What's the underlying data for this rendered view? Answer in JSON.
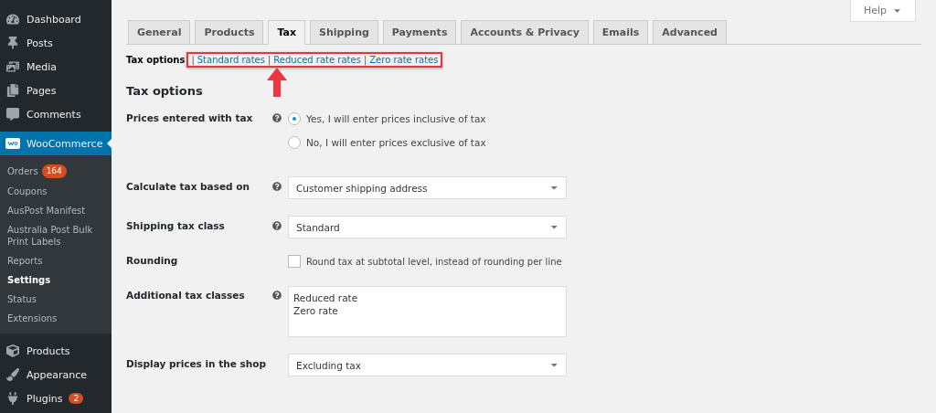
{
  "sidebar": {
    "items": [
      {
        "kind": "menu",
        "label": "Dashboard",
        "selected": false
      },
      {
        "kind": "menu",
        "label": "Posts",
        "selected": false
      },
      {
        "kind": "menu",
        "label": "Media",
        "selected": false
      },
      {
        "kind": "menu",
        "label": "Pages",
        "selected": false
      },
      {
        "kind": "menu",
        "label": "Comments",
        "selected": false
      },
      {
        "kind": "menu",
        "label": "WooCommerce",
        "selected": true,
        "children": [
          {
            "label": "Orders",
            "badge": "164",
            "selected": false
          },
          {
            "label": "Coupons",
            "selected": false
          },
          {
            "label": "AusPost Manifest",
            "selected": false
          },
          {
            "label": "Australia Post Bulk Print Labels",
            "selected": false
          },
          {
            "label": "Reports",
            "selected": false
          },
          {
            "label": "Settings",
            "selected": true
          },
          {
            "label": "Status",
            "selected": false
          },
          {
            "label": "Extensions",
            "selected": false
          }
        ]
      },
      {
        "kind": "menu",
        "label": "Products",
        "selected": false
      },
      {
        "kind": "menu",
        "label": "Appearance",
        "selected": false
      },
      {
        "kind": "menu",
        "label": "Plugins",
        "badge": "2",
        "selected": false
      }
    ]
  },
  "help_button": {
    "label": "Help"
  },
  "tabs": [
    {
      "label": "General",
      "selected": false
    },
    {
      "label": "Products",
      "selected": false
    },
    {
      "label": "Tax",
      "selected": true
    },
    {
      "label": "Shipping",
      "selected": false
    },
    {
      "label": "Payments",
      "selected": false
    },
    {
      "label": "Accounts & Privacy",
      "selected": false
    },
    {
      "label": "Emails",
      "selected": false
    },
    {
      "label": "Advanced",
      "selected": false
    }
  ],
  "subnav": {
    "current": "Tax options",
    "links": [
      {
        "separator": "|",
        "label": "Standard rates"
      },
      {
        "separator": "|",
        "label": "Reduced rate rates"
      },
      {
        "separator": "|",
        "label": "Zero rate rates"
      }
    ],
    "highlighted": true
  },
  "section_title": "Tax options",
  "rows": [
    {
      "kind": "radio",
      "label": "Prices entered with tax",
      "help": true,
      "options": [
        {
          "label": "Yes, I will enter prices inclusive of tax",
          "selected": true
        },
        {
          "label": "No, I will enter prices exclusive of tax",
          "selected": false
        }
      ]
    },
    {
      "kind": "select",
      "label": "Calculate tax based on",
      "help": true,
      "value": "Customer shipping address"
    },
    {
      "kind": "select",
      "label": "Shipping tax class",
      "help": true,
      "value": "Standard"
    },
    {
      "kind": "checkbox",
      "label": "Rounding",
      "help": false,
      "text": "Round tax at subtotal level, instead of rounding per line",
      "checked": false
    },
    {
      "kind": "textarea",
      "label": "Additional tax classes",
      "help": true,
      "value": "Reduced rate\nZero rate"
    },
    {
      "kind": "select",
      "label": "Display prices in the shop",
      "help": false,
      "value": "Excluding tax"
    }
  ]
}
